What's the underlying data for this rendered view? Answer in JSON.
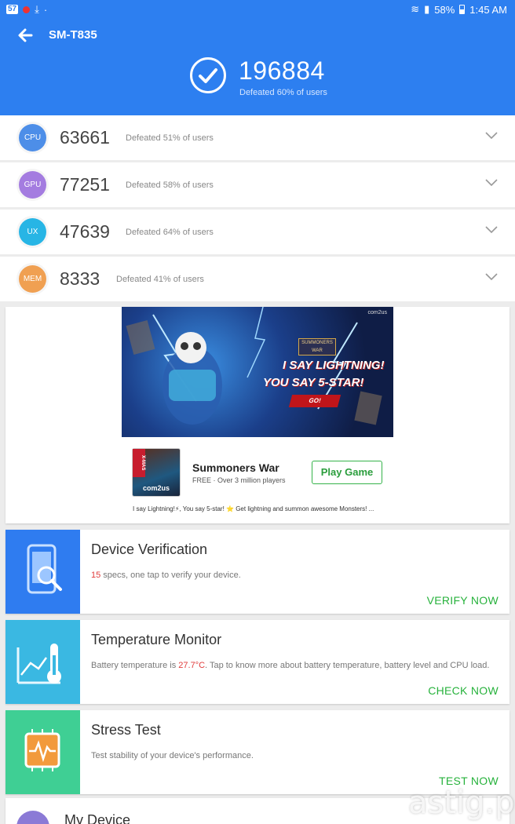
{
  "statusbar": {
    "notif_count": "57",
    "battery": "58%",
    "time": "1:45 AM"
  },
  "header": {
    "device": "SM-T835",
    "total_score": "196884",
    "total_sub": "Defeated 60% of users"
  },
  "scores": [
    {
      "badge": "CPU",
      "value": "63661",
      "sub": "Defeated 51% of users",
      "color": "#4d8ee8"
    },
    {
      "badge": "GPU",
      "value": "77251",
      "sub": "Defeated 58% of users",
      "color": "#a47ce0"
    },
    {
      "badge": "UX",
      "value": "47639",
      "sub": "Defeated 64% of users",
      "color": "#27b5e5"
    },
    {
      "badge": "MEM",
      "value": "8333",
      "sub": "Defeated 41% of users",
      "color": "#f0a052"
    }
  ],
  "ad": {
    "tag": "com2us",
    "game_logo": "SUMMONERS WAR",
    "line1": "I SAY LIGHTNING!",
    "line2": "YOU SAY 5-STAR!",
    "go": "GO!",
    "icon_badge": "X-MAS",
    "icon_brand": "com2us",
    "app_name": "Summoners War",
    "app_meta": "FREE · Over 3 million players",
    "cta": "Play Game",
    "description": "I say Lightning!⚡, You say 5-star! ⭐ Get lightning and summon awesome Monsters! ..."
  },
  "features": {
    "verify": {
      "title": "Device Verification",
      "count": "15",
      "desc_rest": " specs, one tap to verify your device.",
      "action": "VERIFY NOW"
    },
    "temp": {
      "title": "Temperature Monitor",
      "desc_pre": "Battery temperature is ",
      "temp": "27.7°C",
      "desc_post": ". Tap to know more about battery temperature, battery level and CPU load.",
      "action": "CHECK NOW"
    },
    "stress": {
      "title": "Stress Test",
      "desc": "Test stability of your device's performance.",
      "action": "TEST NOW"
    },
    "mydevice": {
      "title": "My Device"
    }
  },
  "watermark": "astig.ph"
}
